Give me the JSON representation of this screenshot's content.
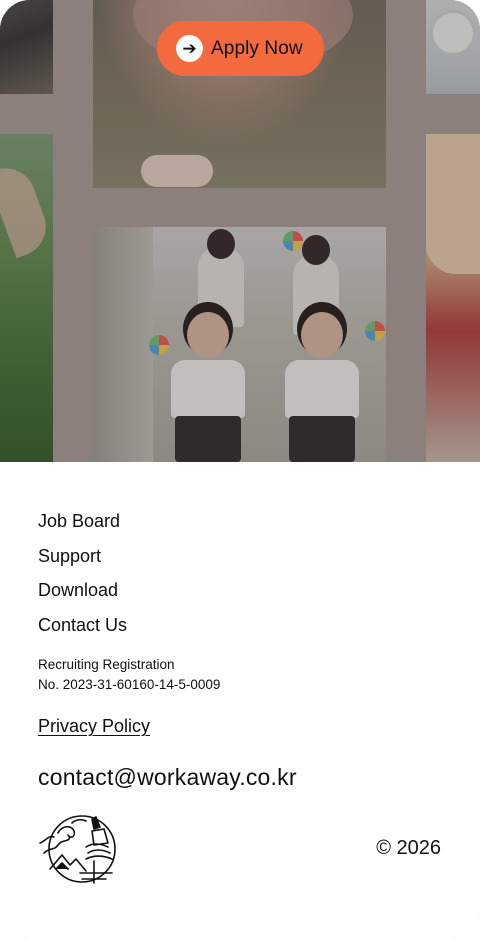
{
  "hero": {
    "apply_button": {
      "label": "Apply Now",
      "icon": "arrow-right-icon"
    },
    "accent_color": "#f26a3d"
  },
  "footer": {
    "nav_links": [
      {
        "label": "Job Board"
      },
      {
        "label": "Support"
      },
      {
        "label": "Download"
      },
      {
        "label": "Contact Us"
      }
    ],
    "registration_line1": "Recruiting Registration",
    "registration_line2": "No. 2023-31-60160-14-5-0009",
    "privacy_policy": "Privacy Policy",
    "email": "contact@workaway.co.kr",
    "copyright": "© 2026",
    "logo_icon": "illustrated-mountain-landscape-logo"
  }
}
